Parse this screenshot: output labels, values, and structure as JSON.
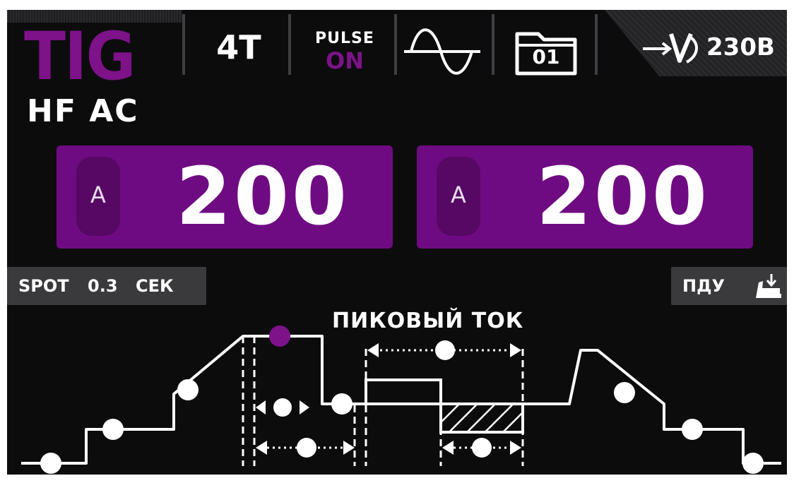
{
  "mode": {
    "process": "TIG",
    "sub": "HF AC"
  },
  "topbar": {
    "trigger": "4T",
    "pulse_label": "PULSE",
    "pulse_state": "ON",
    "memory_slot": "01",
    "voltage": "230B"
  },
  "current_boxes": [
    {
      "unit": "A",
      "value": "200"
    },
    {
      "unit": "A",
      "value": "200"
    }
  ],
  "spot": {
    "label": "SPOT",
    "value": "0.3",
    "unit": "СЕК"
  },
  "remote": {
    "label": "ПДУ"
  },
  "diagram": {
    "peak_label": "ПИКОВЫЙ ТОК"
  },
  "colors": {
    "accent": "#7d1289",
    "panel": "#6f0b82",
    "background": "#0c0c0d",
    "pill": "#3a3a3c",
    "text": "#ffffff"
  },
  "icons": [
    "ac-sine-wave-icon",
    "memory-folder-icon",
    "voltage-icon",
    "remote-control-torch-icon"
  ]
}
